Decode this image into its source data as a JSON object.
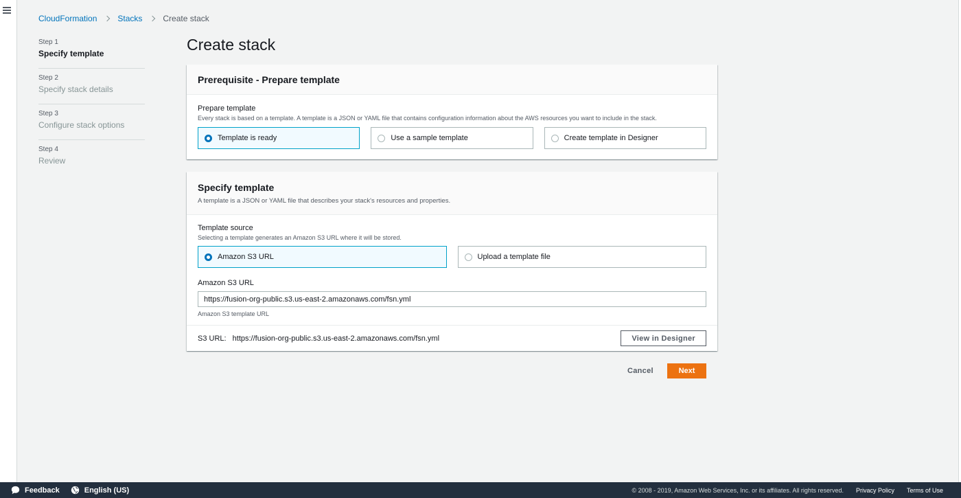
{
  "breadcrumb": {
    "root": "CloudFormation",
    "stacks": "Stacks",
    "current": "Create stack"
  },
  "steps": [
    {
      "num": "Step 1",
      "name": "Specify template"
    },
    {
      "num": "Step 2",
      "name": "Specify stack details"
    },
    {
      "num": "Step 3",
      "name": "Configure stack options"
    },
    {
      "num": "Step 4",
      "name": "Review"
    }
  ],
  "page_title": "Create stack",
  "prereq": {
    "title": "Prerequisite - Prepare template",
    "field_label": "Prepare template",
    "field_desc": "Every stack is based on a template. A template is a JSON or YAML file that contains configuration information about the AWS resources you want to include in the stack.",
    "options": [
      "Template is ready",
      "Use a sample template",
      "Create template in Designer"
    ],
    "selected": "Template is ready"
  },
  "specify": {
    "title": "Specify template",
    "desc": "A template is a JSON or YAML file that describes your stack's resources and properties.",
    "source_label": "Template source",
    "source_desc": "Selecting a template generates an Amazon S3 URL where it will be stored.",
    "options": [
      "Amazon S3 URL",
      "Upload a template file"
    ],
    "selected": "Amazon S3 URL",
    "url_label": "Amazon S3 URL",
    "url_value": "https://fusion-org-public.s3.us-east-2.amazonaws.com/fsn.yml",
    "url_hint": "Amazon S3 template URL",
    "s3_key": "S3 URL:",
    "s3_value": "https://fusion-org-public.s3.us-east-2.amazonaws.com/fsn.yml",
    "view_designer": "View in Designer"
  },
  "actions": {
    "cancel": "Cancel",
    "next": "Next"
  },
  "footer": {
    "feedback": "Feedback",
    "language": "English (US)",
    "copyright": "© 2008 - 2019, Amazon Web Services, Inc. or its affiliates. All rights reserved.",
    "privacy": "Privacy Policy",
    "terms": "Terms of Use"
  }
}
